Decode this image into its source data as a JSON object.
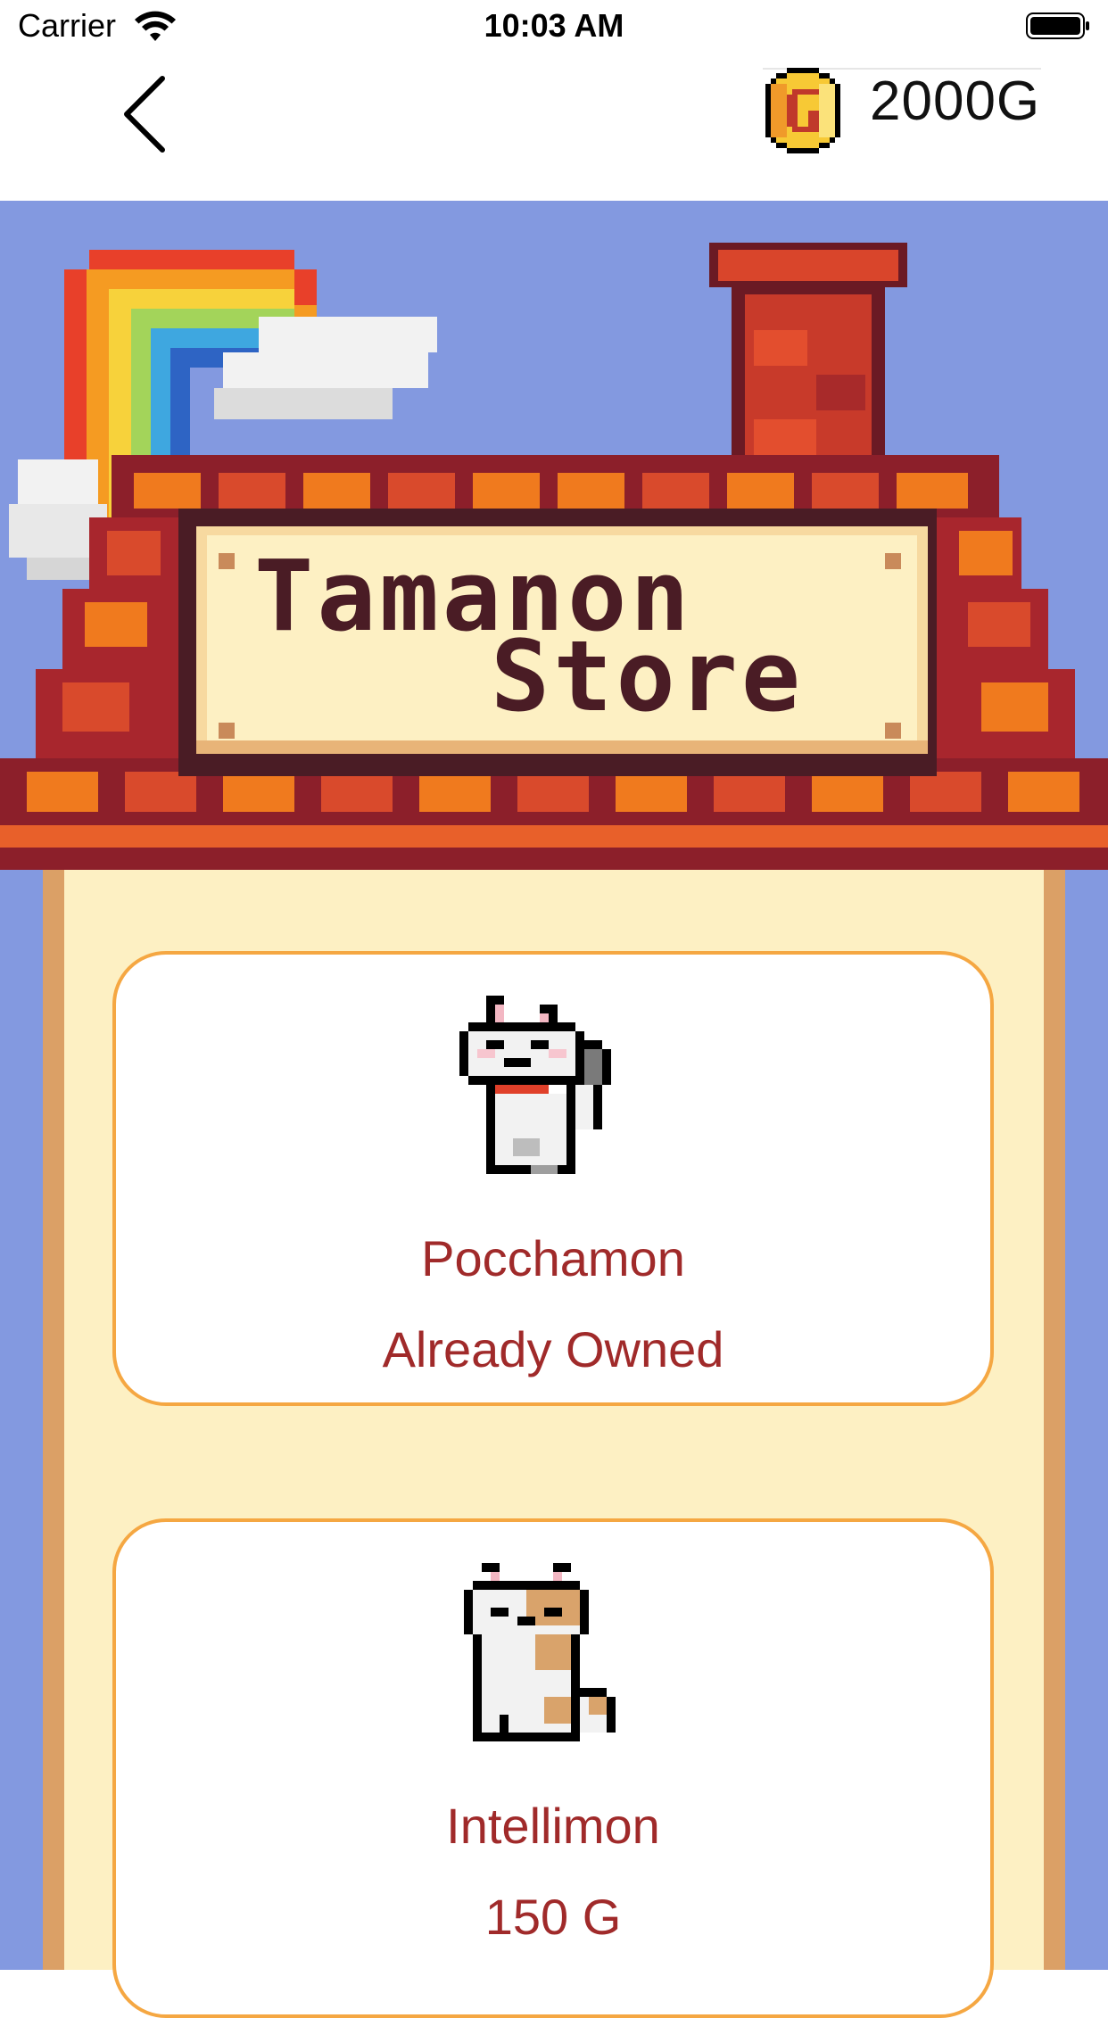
{
  "status_bar": {
    "carrier": "Carrier",
    "time": "10:03 AM"
  },
  "nav": {
    "back_icon": "chevron-left-icon",
    "coin_icon": "coin-icon",
    "coin_amount": "2000G"
  },
  "banner": {
    "title_line1": "Tamanon",
    "title_line2": "Store"
  },
  "items": [
    {
      "name": "Pocchamon",
      "status": "Already Owned",
      "sprite": "white-cat-sprite"
    },
    {
      "name": "Intellimon",
      "status": "150 G",
      "sprite": "calico-cat-sprite"
    }
  ],
  "colors": {
    "sky": "#8399e0",
    "shelf": "#fdf0c3",
    "shelf_edge": "#dba066",
    "card_border": "#f5a742",
    "text_accent": "#a02a2a"
  }
}
